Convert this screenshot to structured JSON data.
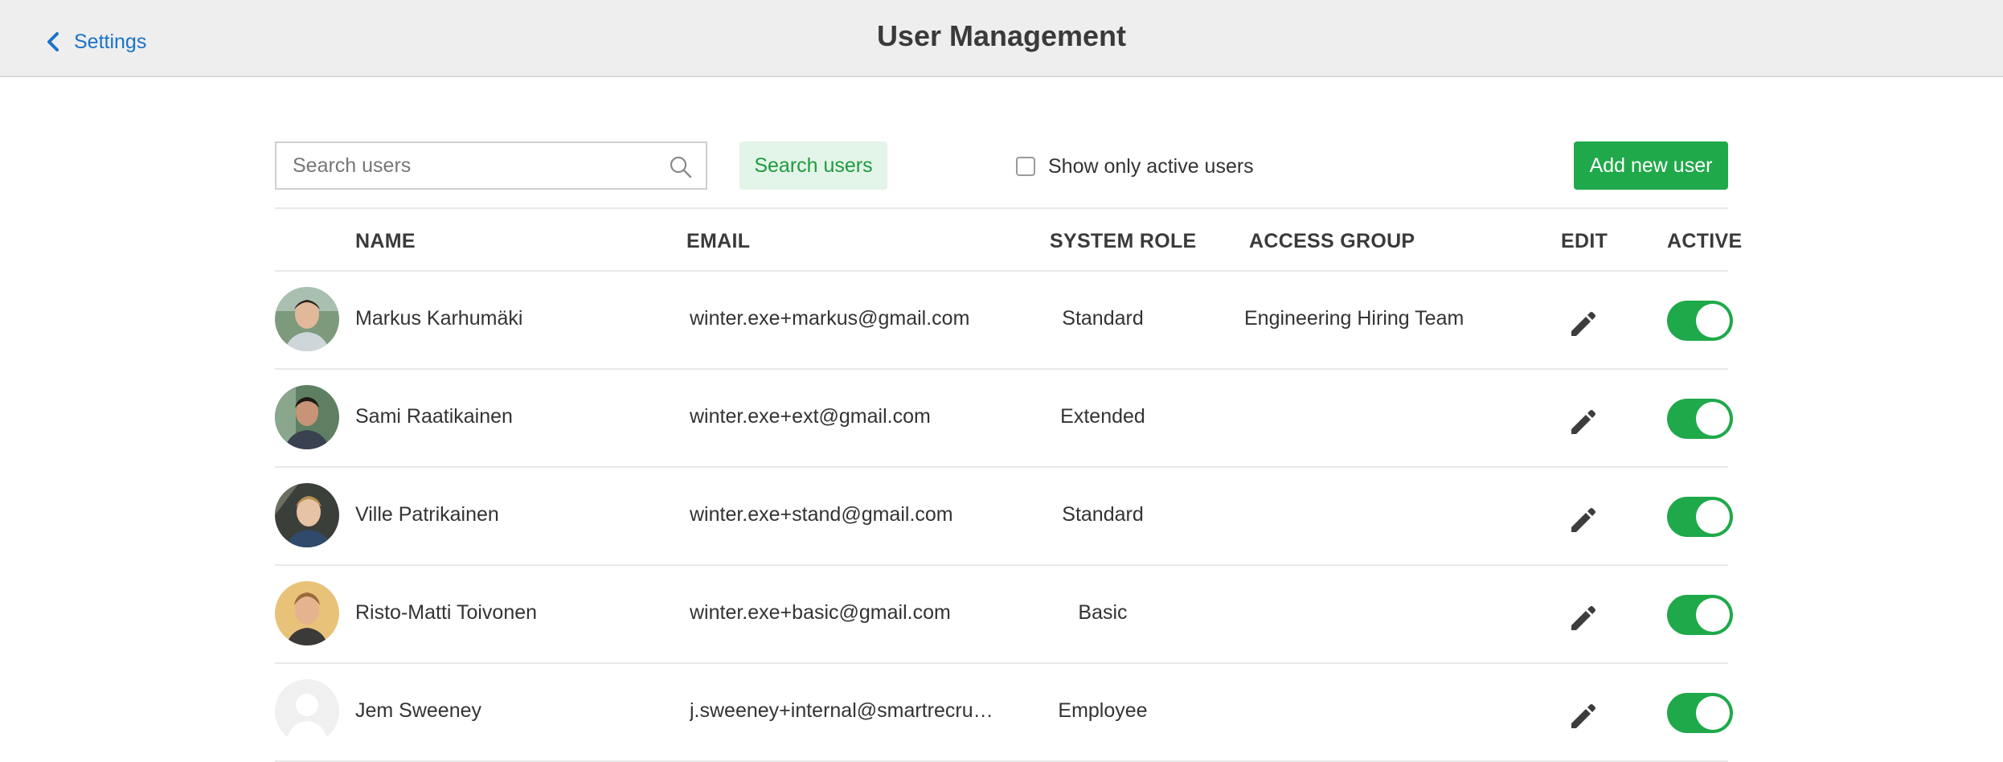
{
  "header": {
    "back_label": "Settings",
    "title": "User Management"
  },
  "toolbar": {
    "search_placeholder": "Search users",
    "search_button": "Search users",
    "active_filter_label": "Show only active users",
    "active_filter_checked": false,
    "add_button": "Add new user"
  },
  "table": {
    "columns": {
      "name": "NAME",
      "email": "EMAIL",
      "role": "SYSTEM ROLE",
      "group": "ACCESS GROUP",
      "edit": "EDIT",
      "active": "ACTIVE"
    },
    "rows": [
      {
        "name": "Markus Karhumäki",
        "email": "winter.exe+markus@gmail.com",
        "role": "Standard",
        "group": "Engineering Hiring Team",
        "active": true,
        "avatar": "photo-avatar"
      },
      {
        "name": "Sami Raatikainen",
        "email": "winter.exe+ext@gmail.com",
        "role": "Extended",
        "group": "",
        "active": true,
        "avatar": "photo-avatar"
      },
      {
        "name": "Ville Patrikainen",
        "email": "winter.exe+stand@gmail.com",
        "role": "Standard",
        "group": "",
        "active": true,
        "avatar": "photo-avatar"
      },
      {
        "name": "Risto-Matti Toivonen",
        "email": "winter.exe+basic@gmail.com",
        "role": "Basic",
        "group": "",
        "active": true,
        "avatar": "photo-avatar"
      },
      {
        "name": "Jem Sweeney",
        "email": "j.sweeney+internal@smartrecruit…",
        "role": "Employee",
        "group": "",
        "active": true,
        "avatar": "placeholder-avatar"
      }
    ]
  },
  "icons": {
    "back": "chevron-left-icon",
    "search": "search-icon",
    "edit": "pencil-icon"
  },
  "colors": {
    "accent_green": "#1fa94a",
    "link_blue": "#1a73c7",
    "search_button_bg": "#e3f5e8",
    "header_bg": "#eeeeee"
  }
}
